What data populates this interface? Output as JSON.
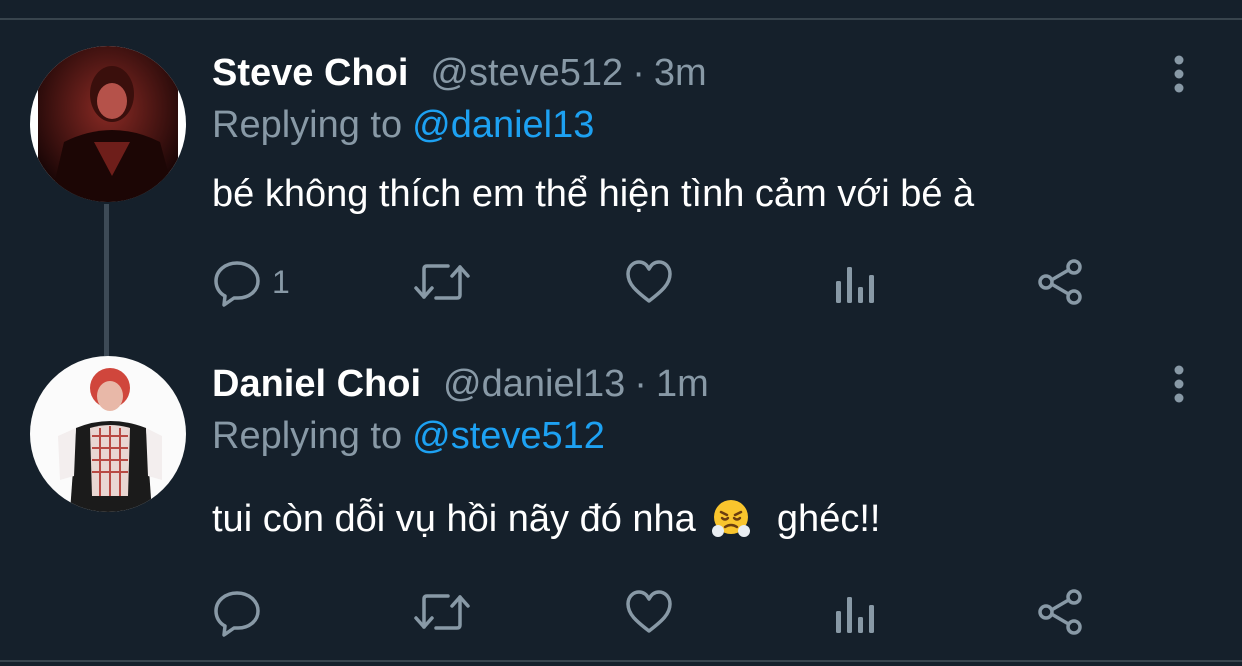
{
  "thread": {
    "tweets": [
      {
        "display_name": "Steve Choi",
        "handle": "@steve512",
        "separator": "·",
        "time": "3m",
        "replying_prefix": "Replying to",
        "replying_to": "@daniel13",
        "text": "bé không thích em thể hiện tình cảm với bé à",
        "reply_count": "1",
        "avatar_icon": "avatar-photo"
      },
      {
        "display_name": "Daniel Choi",
        "handle": "@daniel13",
        "separator": "·",
        "time": "1m",
        "replying_prefix": "Replying to",
        "replying_to": "@steve512",
        "text_before_emoji": "tui còn dỗi vụ hồi nãy đó nha",
        "emoji_icon": "face-with-steam-from-nose-emoji",
        "text_after_emoji": "ghéc!!",
        "avatar_icon": "avatar-photo"
      }
    ]
  },
  "colors": {
    "background": "#15202b",
    "primary_text": "#ffffff",
    "secondary_text": "#8899a6",
    "accent": "#1da1f2",
    "divider": "#38444d"
  },
  "icons": [
    "reply-icon",
    "retweet-icon",
    "like-icon",
    "analytics-icon",
    "share-icon",
    "more-icon"
  ]
}
